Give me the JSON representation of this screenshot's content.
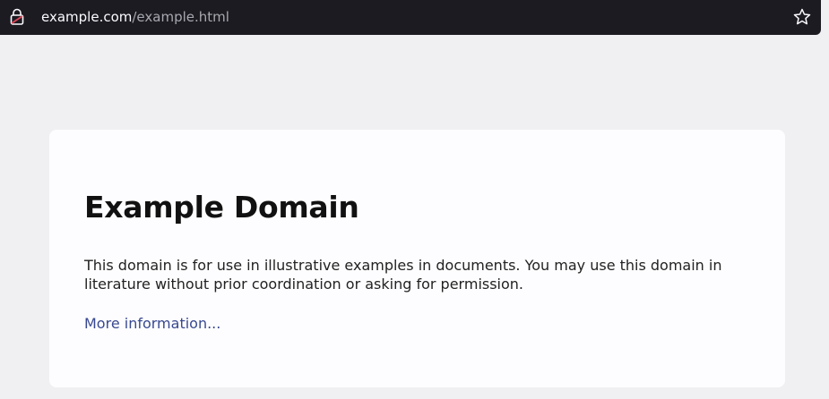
{
  "browser": {
    "url_domain": "example.com",
    "url_path": "/example.html",
    "icons": {
      "site_info": "site-info-icon",
      "bookmark": "bookmark-star-icon"
    }
  },
  "page": {
    "heading": "Example Domain",
    "body": "This domain is for use in illustrative examples in documents. You may use this domain in literature without prior coordination or asking for permission.",
    "link_text": "More information..."
  },
  "colors": {
    "page_background": "#f0f0f2",
    "card_background": "#fdfdff",
    "url_bar": "#1c1b22",
    "link": "#38488f",
    "lock_accent": "#e0465a"
  }
}
